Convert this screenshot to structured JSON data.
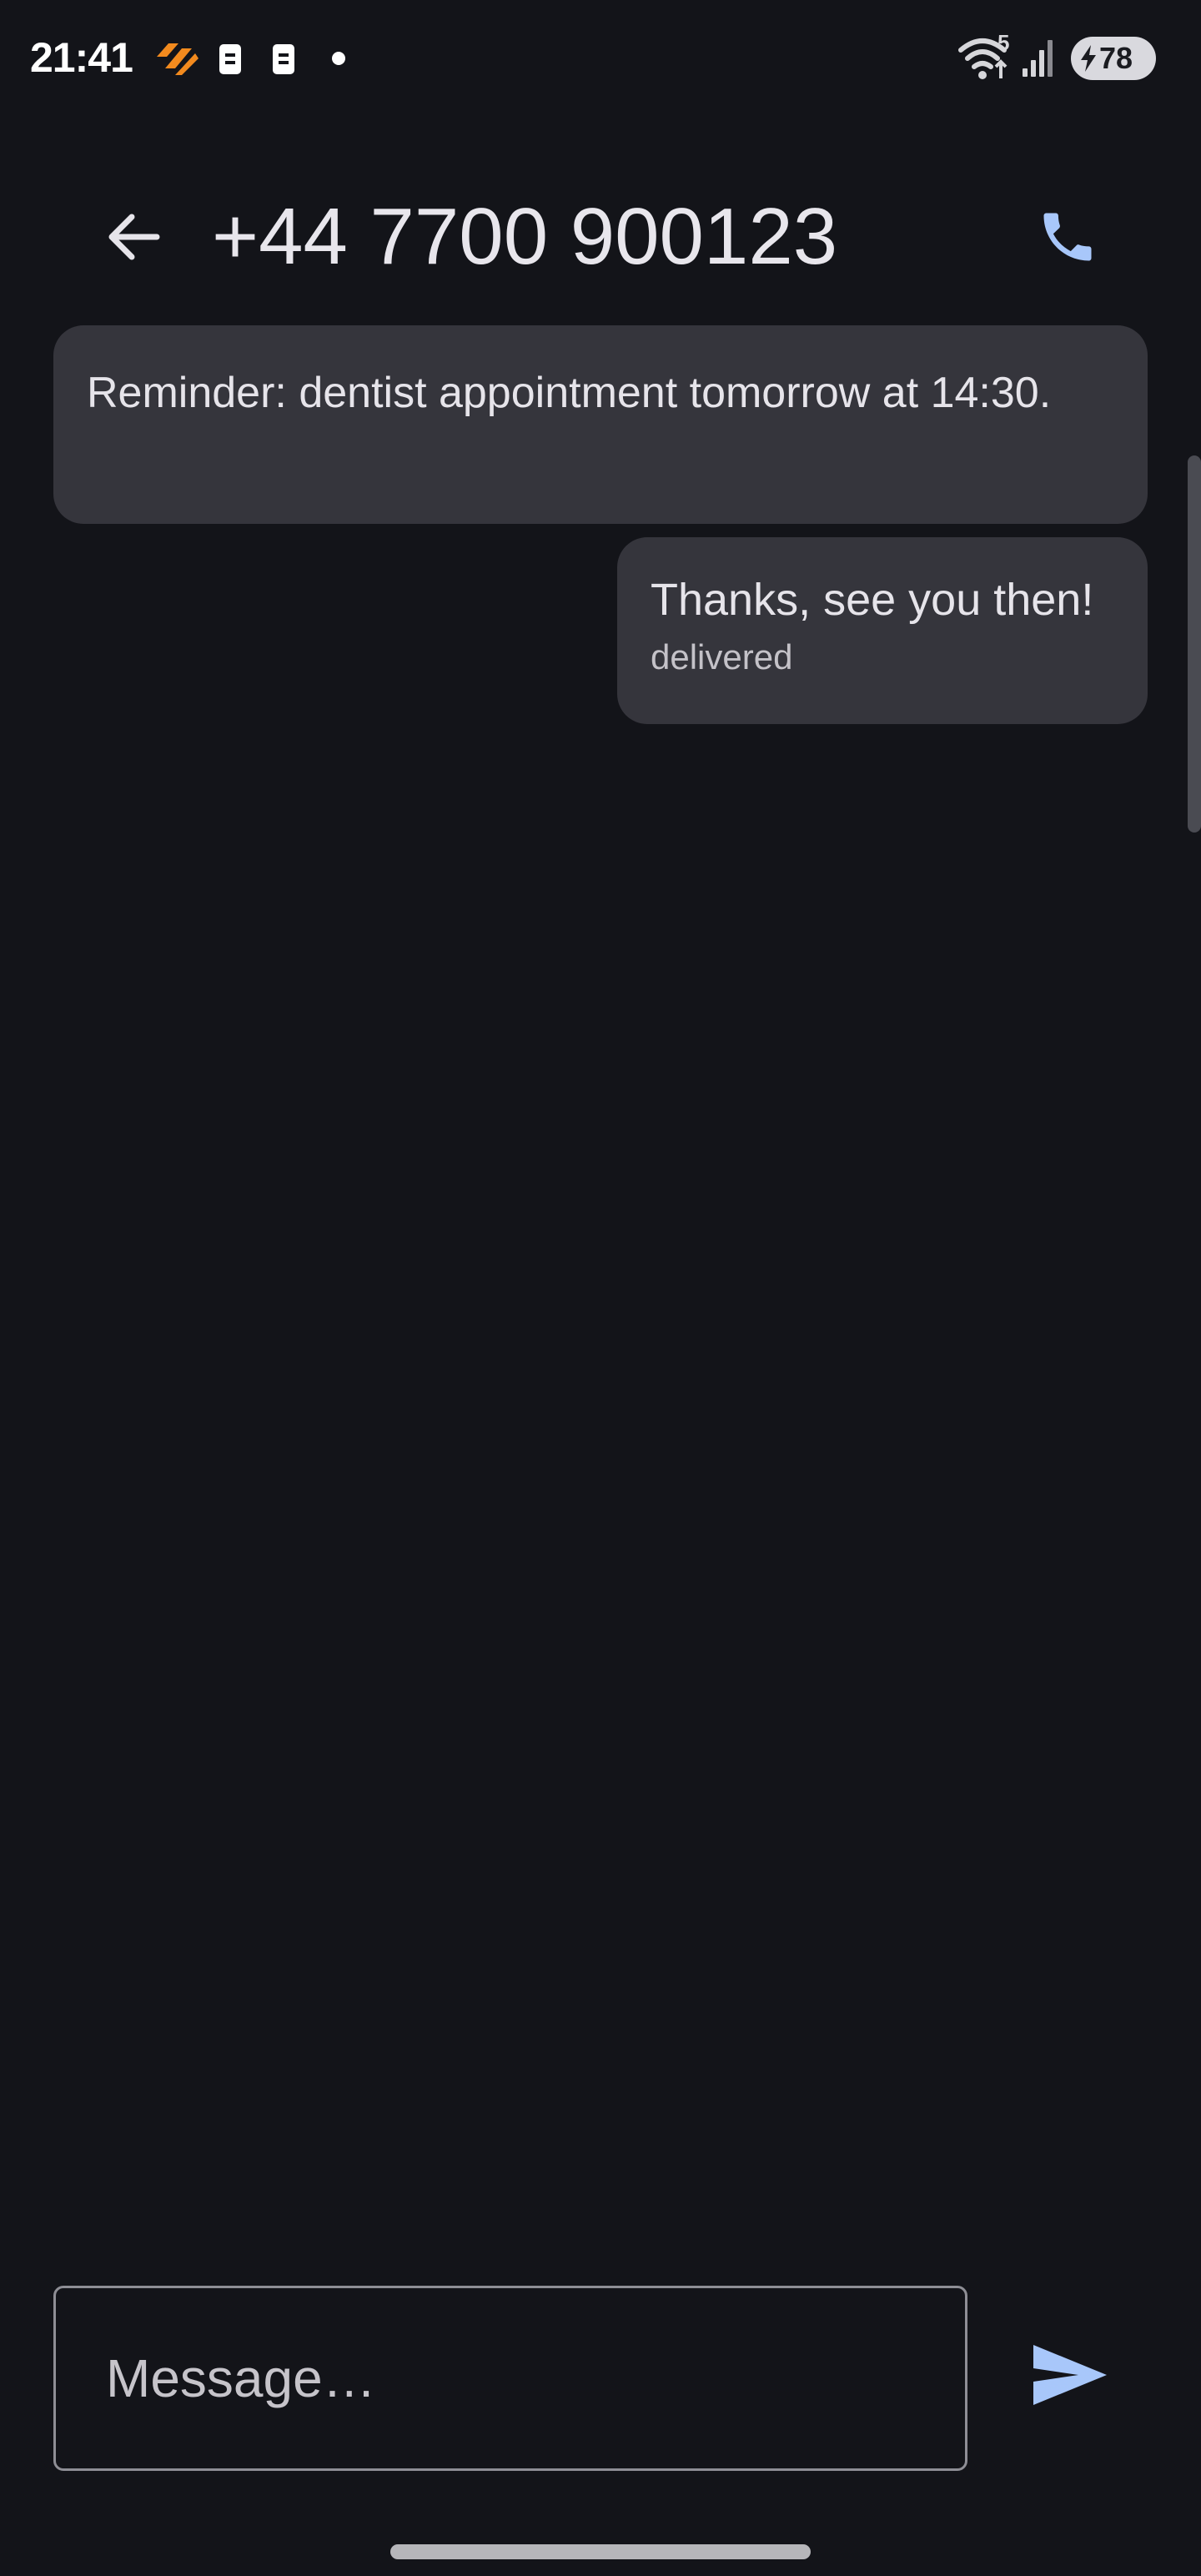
{
  "status_bar": {
    "time": "21:41",
    "battery_level": "78",
    "wifi_badge": "5"
  },
  "header": {
    "title": "+44 7700 900123"
  },
  "messages": [
    {
      "direction": "incoming",
      "text": "Reminder: dentist appointment tomorrow at 14:30."
    },
    {
      "direction": "outgoing",
      "text": "Thanks, see you then!",
      "status": "delivered"
    }
  ],
  "composer": {
    "placeholder": "Message…"
  },
  "colors": {
    "background": "#131419",
    "bubble": "#35353c",
    "accent": "#a8c7fa",
    "notification_orange": "#f28a1e"
  },
  "icons": {
    "back": "arrow-left-icon",
    "call": "phone-icon",
    "send": "send-icon"
  }
}
